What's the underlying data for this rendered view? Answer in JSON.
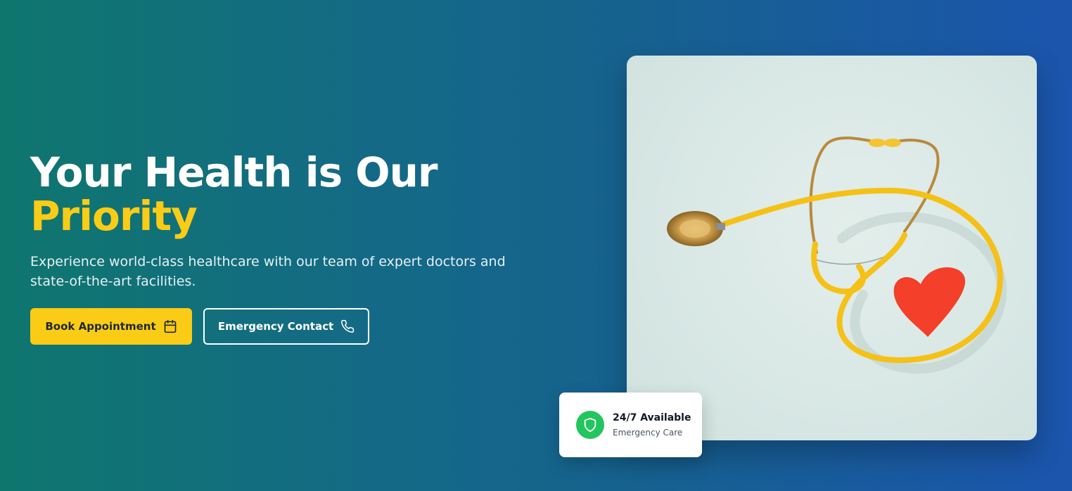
{
  "hero": {
    "title_line1": "Your Health is Our",
    "title_accent": "Priority",
    "subtitle": "Experience world-class healthcare with our team of expert doctors and state-of-the-art facilities.",
    "primary_button": {
      "label": "Book Appointment",
      "icon": "calendar-icon"
    },
    "secondary_button": {
      "label": "Emergency Contact",
      "icon": "phone-icon"
    }
  },
  "image": {
    "subject": "stethoscope-with-heart",
    "alt": "Yellow stethoscope with red paper heart"
  },
  "badge": {
    "icon": "shield-icon",
    "title": "24/7 Available",
    "subtitle": "Emergency Care"
  },
  "colors": {
    "accent": "#facc15",
    "gradient_start": "#0f766e",
    "gradient_end": "#1b55ad",
    "badge_icon_bg": "#22c55e"
  }
}
